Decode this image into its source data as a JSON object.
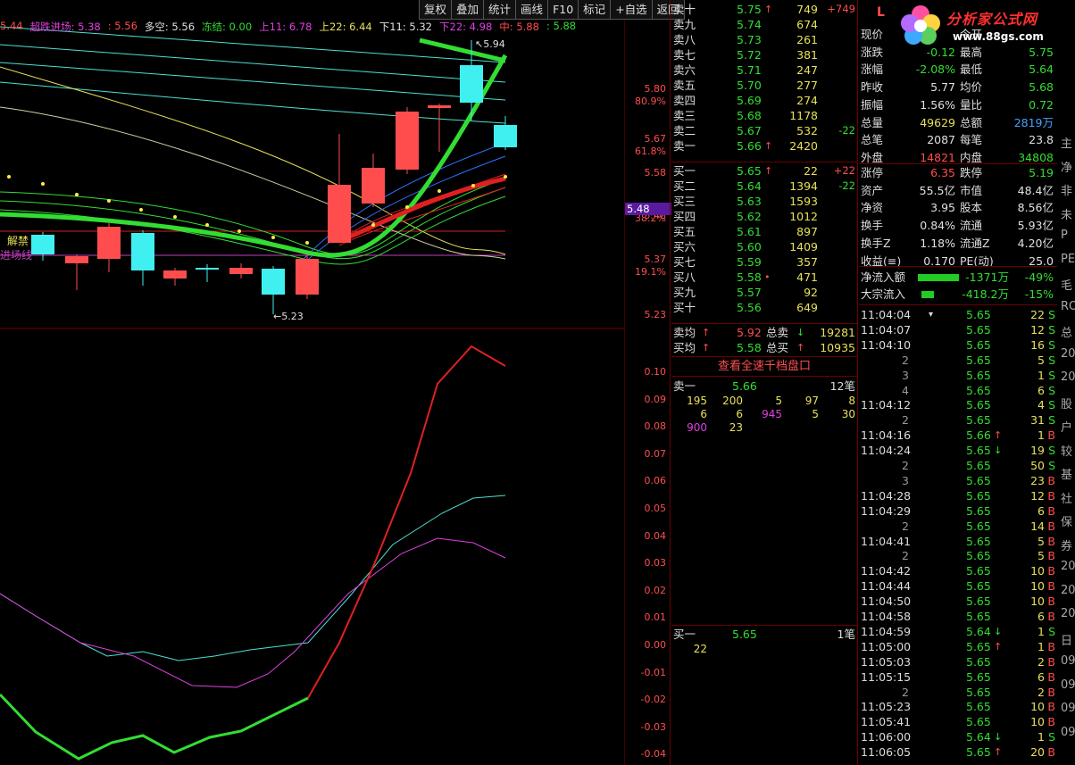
{
  "toolbar": [
    "复权",
    "叠加",
    "统计",
    "画线",
    "F10",
    "标记",
    "+自选",
    "返回"
  ],
  "indicator_line": [
    {
      "text": "5.44",
      "color": "#ff4d4d"
    },
    {
      "text": "超跌进场: 5.38",
      "color": "#e040e0"
    },
    {
      "text": ": 5.56",
      "color": "#ff4d4d"
    },
    {
      "text": "多空: 5.56",
      "color": "#e0e0e0"
    },
    {
      "text": "冻结: 0.00",
      "color": "#33dd33"
    },
    {
      "text": "上11: 6.78",
      "color": "#e040e0"
    },
    {
      "text": "上22: 6.44",
      "color": "#e8e05a"
    },
    {
      "text": "下11: 5.32",
      "color": "#e0e0e0"
    },
    {
      "text": "下22: 4.98",
      "color": "#e040e0"
    },
    {
      "text": "中: 5.88",
      "color": "#ff4d4d"
    },
    {
      "text": ": 5.88",
      "color": "#33dd33"
    }
  ],
  "main_chart": {
    "price_axis": [
      {
        "price": "5.80",
        "pct": "80.9%"
      },
      {
        "price": "5.67",
        "pct": "61.8%"
      },
      {
        "price": "5.58",
        "pct": ""
      },
      {
        "price": "5.48",
        "pct": "38.2%"
      },
      {
        "price": "5.37",
        "pct": "19.1%"
      },
      {
        "price": "5.23",
        "pct": ""
      }
    ],
    "current_price_tag": "5.48",
    "high_marker": "5.94",
    "low_marker": "5.23",
    "labels": [
      "解禁",
      "进场线"
    ]
  },
  "osc_axis": [
    "0.10",
    "0.09",
    "0.08",
    "0.07",
    "0.06",
    "0.05",
    "0.04",
    "0.03",
    "0.02",
    "0.01",
    "0.00",
    "-0.01",
    "-0.02",
    "-0.03",
    "-0.04"
  ],
  "order_book": {
    "asks": [
      {
        "label": "卖十",
        "price": "5.75",
        "arrow": "↑",
        "vol": "749",
        "chg": "+749",
        "chg_color": "#ff4d4d"
      },
      {
        "label": "卖九",
        "price": "5.74",
        "arrow": "",
        "vol": "674",
        "chg": "",
        "chg_color": ""
      },
      {
        "label": "卖八",
        "price": "5.73",
        "arrow": "",
        "vol": "261",
        "chg": "",
        "chg_color": ""
      },
      {
        "label": "卖七",
        "price": "5.72",
        "arrow": "",
        "vol": "381",
        "chg": "",
        "chg_color": ""
      },
      {
        "label": "卖六",
        "price": "5.71",
        "arrow": "",
        "vol": "247",
        "chg": "",
        "chg_color": ""
      },
      {
        "label": "卖五",
        "price": "5.70",
        "arrow": "",
        "vol": "277",
        "chg": "",
        "chg_color": ""
      },
      {
        "label": "卖四",
        "price": "5.69",
        "arrow": "",
        "vol": "274",
        "chg": "",
        "chg_color": ""
      },
      {
        "label": "卖三",
        "price": "5.68",
        "arrow": "",
        "vol": "1178",
        "chg": "",
        "chg_color": ""
      },
      {
        "label": "卖二",
        "price": "5.67",
        "arrow": "",
        "vol": "532",
        "chg": "-22",
        "chg_color": "#33dd33"
      },
      {
        "label": "卖一",
        "price": "5.66",
        "arrow": "↑",
        "vol": "2420",
        "chg": "",
        "chg_color": ""
      }
    ],
    "bids": [
      {
        "label": "买一",
        "price": "5.65",
        "arrow": "↑",
        "vol": "22",
        "chg": "+22",
        "chg_color": "#ff4d4d"
      },
      {
        "label": "买二",
        "price": "5.64",
        "arrow": "",
        "vol": "1394",
        "chg": "-22",
        "chg_color": "#33dd33"
      },
      {
        "label": "买三",
        "price": "5.63",
        "arrow": "",
        "vol": "1593",
        "chg": "",
        "chg_color": ""
      },
      {
        "label": "买四",
        "price": "5.62",
        "arrow": "",
        "vol": "1012",
        "chg": "",
        "chg_color": ""
      },
      {
        "label": "买五",
        "price": "5.61",
        "arrow": "",
        "vol": "897",
        "chg": "",
        "chg_color": ""
      },
      {
        "label": "买六",
        "price": "5.60",
        "arrow": "",
        "vol": "1409",
        "chg": "",
        "chg_color": ""
      },
      {
        "label": "买七",
        "price": "5.59",
        "arrow": "",
        "vol": "357",
        "chg": "",
        "chg_color": ""
      },
      {
        "label": "买八",
        "price": "5.58",
        "arrow": "•",
        "vol": "471",
        "chg": "",
        "chg_color": ""
      },
      {
        "label": "买九",
        "price": "5.57",
        "arrow": "",
        "vol": "92",
        "chg": "",
        "chg_color": ""
      },
      {
        "label": "买十",
        "price": "5.56",
        "arrow": "",
        "vol": "649",
        "chg": "",
        "chg_color": ""
      }
    ],
    "avg": [
      {
        "l1": "卖均",
        "a1": "↑",
        "v1": "5.92",
        "l2": "总卖",
        "a2": "↓",
        "v2": "19281"
      },
      {
        "l1": "买均",
        "a1": "↑",
        "v1": "5.58",
        "l2": "总买",
        "a2": "↑",
        "v2": "10935"
      }
    ],
    "depth_button": "查看全速千档盘口",
    "queue_sell": {
      "label": "卖一",
      "price": "5.66",
      "count": "12笔",
      "rows": [
        [
          "195",
          "200",
          "5",
          "97",
          "8"
        ],
        [
          "6",
          "6",
          "945",
          "5",
          "30"
        ],
        [
          "900",
          "23"
        ]
      ]
    },
    "queue_buy": {
      "label": "买一",
      "price": "5.65",
      "count": "1笔",
      "rows": [
        [
          "22"
        ]
      ]
    }
  },
  "quote": {
    "title": "L",
    "rows": [
      {
        "l1": "现价",
        "v1": "",
        "c1": "#33dd33",
        "l2": "今开",
        "v2": "",
        "c2": "#33dd33"
      },
      {
        "l1": "涨跌",
        "v1": "-0.12",
        "c1": "#33dd33",
        "l2": "最高",
        "v2": "5.75",
        "c2": "#33dd33"
      },
      {
        "l1": "涨幅",
        "v1": "-2.08%",
        "c1": "#33dd33",
        "l2": "最低",
        "v2": "5.64",
        "c2": "#33dd33"
      },
      {
        "l1": "昨收",
        "v1": "5.77",
        "c1": "#e0e0e0",
        "l2": "均价",
        "v2": "5.68",
        "c2": "#33dd33"
      },
      {
        "l1": "振幅",
        "v1": "1.56%",
        "c1": "#e0e0e0",
        "l2": "量比",
        "v2": "0.72",
        "c2": "#33dd33"
      },
      {
        "l1": "总量",
        "v1": "49629",
        "c1": "#e8e05a",
        "l2": "总额",
        "v2": "2819万",
        "c2": "#46a0ff"
      },
      {
        "l1": "总笔",
        "v1": "2087",
        "c1": "#e0e0e0",
        "l2": "每笔",
        "v2": "23.8",
        "c2": "#e0e0e0"
      },
      {
        "l1": "外盘",
        "v1": "14821",
        "c1": "#ff4d4d",
        "l2": "内盘",
        "v2": "34808",
        "c2": "#33dd33"
      },
      {
        "l1": "涨停",
        "v1": "6.35",
        "c1": "#ff4d4d",
        "l2": "跌停",
        "v2": "5.19",
        "c2": "#33dd33"
      },
      {
        "l1": "资产",
        "v1": "55.5亿",
        "c1": "#e0e0e0",
        "l2": "市值",
        "v2": "48.4亿",
        "c2": "#e0e0e0"
      },
      {
        "l1": "净资",
        "v1": "3.95",
        "c1": "#e0e0e0",
        "l2": "股本",
        "v2": "8.56亿",
        "c2": "#e0e0e0"
      },
      {
        "l1": "换手",
        "v1": "0.84%",
        "c1": "#e0e0e0",
        "l2": "流通",
        "v2": "5.93亿",
        "c2": "#e0e0e0"
      },
      {
        "l1": "换手Z",
        "v1": "1.18%",
        "c1": "#e0e0e0",
        "l2": "流通Z",
        "v2": "4.20亿",
        "c2": "#e0e0e0"
      },
      {
        "l1": "收益(≡)",
        "v1": "0.170",
        "c1": "#e0e0e0",
        "l2": "PE(动)",
        "v2": "25.0",
        "c2": "#e0e0e0"
      }
    ],
    "flows": [
      {
        "label": "净流入额",
        "bar": 1.0,
        "amount": "-1371万",
        "pct": "-49%"
      },
      {
        "label": "大宗流入",
        "bar": 0.3,
        "amount": "-418.2万",
        "pct": "-15%"
      }
    ]
  },
  "ticks": [
    {
      "time": "11:04:04",
      "mark": "▾",
      "price": "5.65",
      "arrow": "",
      "vol": "22",
      "bs": "S"
    },
    {
      "time": "11:04:07",
      "mark": "",
      "price": "5.65",
      "arrow": "",
      "vol": "12",
      "bs": "S"
    },
    {
      "time": "11:04:10",
      "mark": "",
      "price": "5.65",
      "arrow": "",
      "vol": "16",
      "bs": "S"
    },
    {
      "time": "2",
      "mark": "",
      "price": "5.65",
      "arrow": "",
      "vol": "5",
      "bs": "S"
    },
    {
      "time": "3",
      "mark": "",
      "price": "5.65",
      "arrow": "",
      "vol": "1",
      "bs": "S"
    },
    {
      "time": "4",
      "mark": "",
      "price": "5.65",
      "arrow": "",
      "vol": "6",
      "bs": "S"
    },
    {
      "time": "11:04:12",
      "mark": "",
      "price": "5.65",
      "arrow": "",
      "vol": "4",
      "bs": "S"
    },
    {
      "time": "2",
      "mark": "",
      "price": "5.65",
      "arrow": "",
      "vol": "31",
      "bs": "S"
    },
    {
      "time": "11:04:16",
      "mark": "",
      "price": "5.66",
      "arrow": "↑",
      "vol": "1",
      "bs": "B"
    },
    {
      "time": "11:04:24",
      "mark": "",
      "price": "5.65",
      "arrow": "↓",
      "vol": "19",
      "bs": "S"
    },
    {
      "time": "2",
      "mark": "",
      "price": "5.65",
      "arrow": "",
      "vol": "50",
      "bs": "S"
    },
    {
      "time": "3",
      "mark": "",
      "price": "5.65",
      "arrow": "",
      "vol": "23",
      "bs": "B"
    },
    {
      "time": "11:04:28",
      "mark": "",
      "price": "5.65",
      "arrow": "",
      "vol": "12",
      "bs": "B"
    },
    {
      "time": "11:04:29",
      "mark": "",
      "price": "5.65",
      "arrow": "",
      "vol": "6",
      "bs": "B"
    },
    {
      "time": "2",
      "mark": "",
      "price": "5.65",
      "arrow": "",
      "vol": "14",
      "bs": "B"
    },
    {
      "time": "11:04:41",
      "mark": "",
      "price": "5.65",
      "arrow": "",
      "vol": "5",
      "bs": "B"
    },
    {
      "time": "2",
      "mark": "",
      "price": "5.65",
      "arrow": "",
      "vol": "5",
      "bs": "B"
    },
    {
      "time": "11:04:42",
      "mark": "",
      "price": "5.65",
      "arrow": "",
      "vol": "10",
      "bs": "B"
    },
    {
      "time": "11:04:44",
      "mark": "",
      "price": "5.65",
      "arrow": "",
      "vol": "10",
      "bs": "B"
    },
    {
      "time": "11:04:50",
      "mark": "",
      "price": "5.65",
      "arrow": "",
      "vol": "10",
      "bs": "B"
    },
    {
      "time": "11:04:58",
      "mark": "",
      "price": "5.65",
      "arrow": "",
      "vol": "6",
      "bs": "B"
    },
    {
      "time": "11:04:59",
      "mark": "",
      "price": "5.64",
      "arrow": "↓",
      "vol": "1",
      "bs": "S"
    },
    {
      "time": "11:05:00",
      "mark": "",
      "price": "5.65",
      "arrow": "↑",
      "vol": "1",
      "bs": "B"
    },
    {
      "time": "11:05:03",
      "mark": "",
      "price": "5.65",
      "arrow": "",
      "vol": "2",
      "bs": "B"
    },
    {
      "time": "11:05:15",
      "mark": "",
      "price": "5.65",
      "arrow": "",
      "vol": "6",
      "bs": "B"
    },
    {
      "time": "2",
      "mark": "",
      "price": "5.65",
      "arrow": "",
      "vol": "2",
      "bs": "B"
    },
    {
      "time": "11:05:23",
      "mark": "",
      "price": "5.65",
      "arrow": "",
      "vol": "10",
      "bs": "B"
    },
    {
      "time": "11:05:41",
      "mark": "",
      "price": "5.65",
      "arrow": "",
      "vol": "10",
      "bs": "B"
    },
    {
      "time": "11:06:00",
      "mark": "",
      "price": "5.64",
      "arrow": "↓",
      "vol": "1",
      "bs": "S"
    },
    {
      "time": "11:06:05",
      "mark": "",
      "price": "5.65",
      "arrow": "↑",
      "vol": "20",
      "bs": "B"
    }
  ],
  "edge_chars": [
    "主",
    "净",
    "非",
    "未",
    "P",
    "PE",
    "毛",
    "RO",
    "总",
    "20",
    "20",
    "股",
    "户",
    "较",
    "基",
    "社",
    "保",
    "券",
    "20",
    "20",
    "20",
    "日",
    "09",
    "09",
    "09",
    "09"
  ],
  "logo": {
    "text": "分析家公式网",
    "url": "www.88gs.com"
  }
}
